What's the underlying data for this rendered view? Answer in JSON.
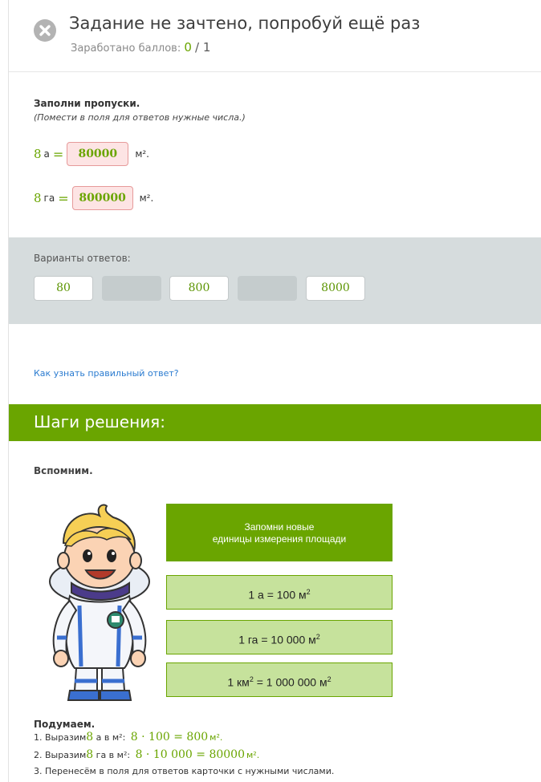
{
  "header": {
    "title": "Задание не зачтено, попробуй ещё раз",
    "score_label": "Заработано баллов:",
    "score_got": "0",
    "score_total": "/ 1"
  },
  "task": {
    "title": "Заполни пропуски.",
    "hint": "(Помести в поля для ответов нужные числа.)",
    "eq1": {
      "num": "8",
      "unit": "а",
      "eq": "=",
      "answer": "80000",
      "result_unit": "м²."
    },
    "eq2": {
      "num": "8",
      "unit": "га",
      "eq": "=",
      "answer": "800000",
      "result_unit": "м²."
    }
  },
  "variants": {
    "label": "Варианты ответов:",
    "cards": [
      "80",
      "",
      "800",
      "",
      "8000"
    ]
  },
  "help_link": "Как узнать правильный ответ?",
  "steps": {
    "title": "Шаги решения:",
    "remember": "Вспомним.",
    "memo_line1": "Запомни новые",
    "memo_line2": "единицы измерения площади",
    "rule1": "1 а = 100 м",
    "rule2": "1 га = 10 000 м",
    "rule3a": "1 км",
    "rule3b": " = 1 000 000 м",
    "sq": "2",
    "think": "Подумаем.",
    "s1_text": "1. Выразим ",
    "s1_num": "8",
    "s1_mid": " а в м²: ",
    "s1_expr": "8 · 100 = 800",
    "s1_unit": "м².",
    "s2_text": "2. Выразим ",
    "s2_num": "8",
    "s2_mid": " га в м²: ",
    "s2_expr": "8 · 10 000 = 80000",
    "s2_unit": "м².",
    "s3": "3. Перенесём в поля для ответов карточки с нужными числами."
  },
  "colors": {
    "accent_green": "#6aa500",
    "error_fill": "#fde4e4",
    "link": "#2a7bd0"
  }
}
